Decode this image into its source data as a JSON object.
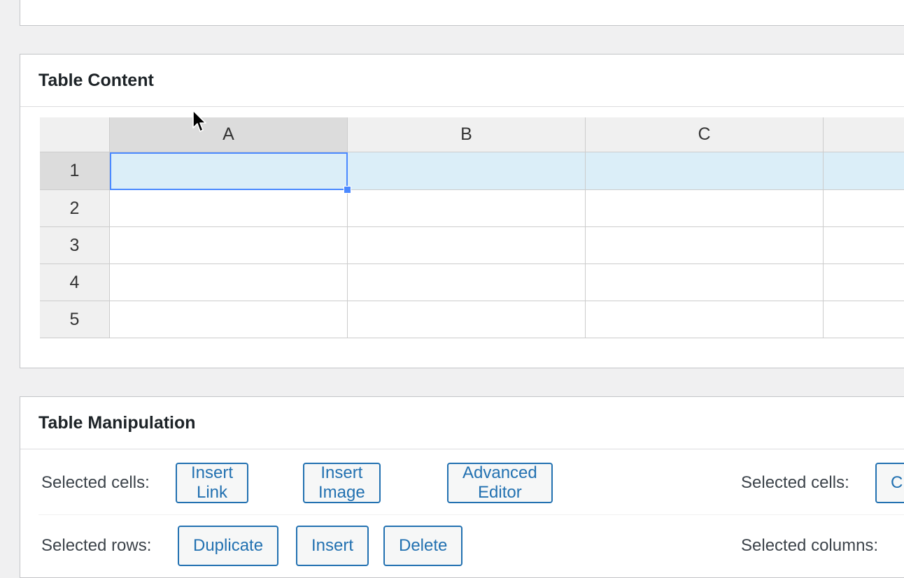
{
  "top_panel": {
    "text": ""
  },
  "content_panel": {
    "title": "Table Content",
    "columns": [
      "A",
      "B",
      "C",
      ""
    ],
    "rows": [
      "1",
      "2",
      "3",
      "4",
      "5"
    ],
    "selected_cell": "A1"
  },
  "manip_panel": {
    "title": "Table Manipulation",
    "cells_label": "Selected cells:",
    "cells_buttons": [
      "Insert Link",
      "Insert Image",
      "Advanced Editor"
    ],
    "cells_label_right": "Selected cells:",
    "cells_button_right": "C",
    "rows_label": "Selected rows:",
    "rows_buttons": [
      "Duplicate",
      "Insert",
      "Delete"
    ],
    "columns_label_right": "Selected columns:"
  },
  "colors": {
    "accent": "#2271b1",
    "selection_border": "#4b89ff",
    "selection_fill": "#dbeef8"
  }
}
